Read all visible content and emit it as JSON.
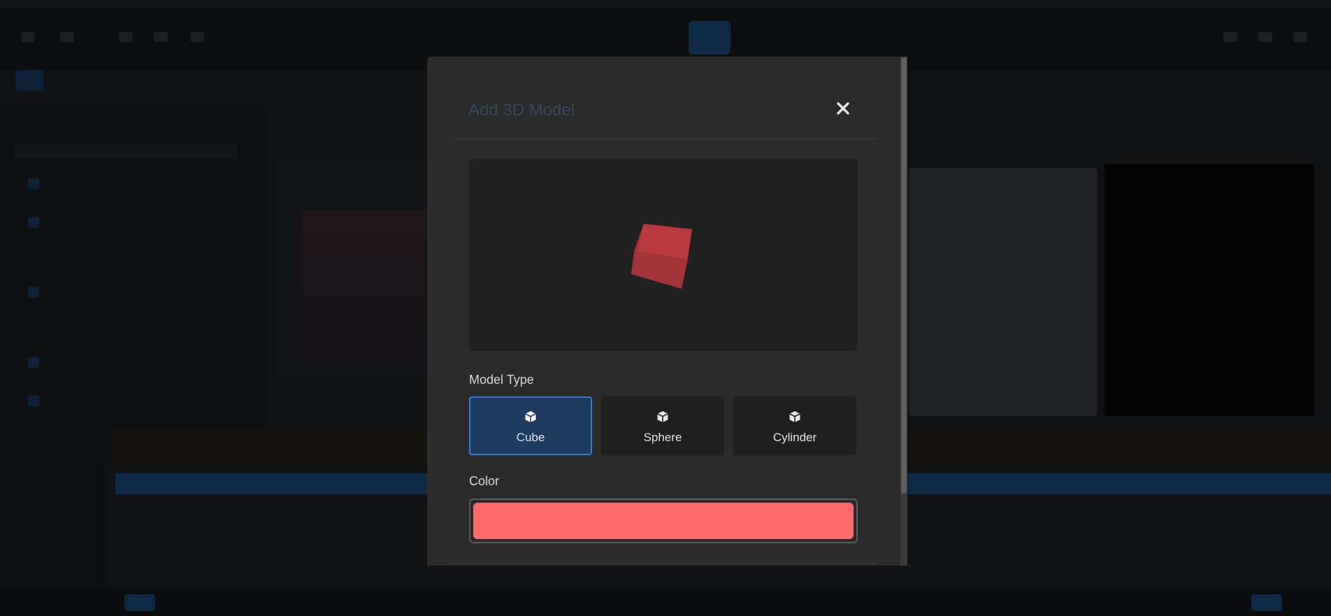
{
  "modal": {
    "title": "Add 3D Model",
    "close_icon": "close-icon"
  },
  "preview": {
    "model_color": "#b83a3e"
  },
  "model_type": {
    "label": "Model Type",
    "selected": "Cube",
    "options": [
      {
        "label": "Cube",
        "icon": "cube-icon",
        "active": true
      },
      {
        "label": "Sphere",
        "icon": "cube-icon",
        "active": false
      },
      {
        "label": "Cylinder",
        "icon": "cube-icon",
        "active": false
      }
    ]
  },
  "color": {
    "label": "Color",
    "value": "#ff6b6b"
  },
  "theme": {
    "accent": "#2f7fd3",
    "active_bg": "#1f3a5f"
  }
}
